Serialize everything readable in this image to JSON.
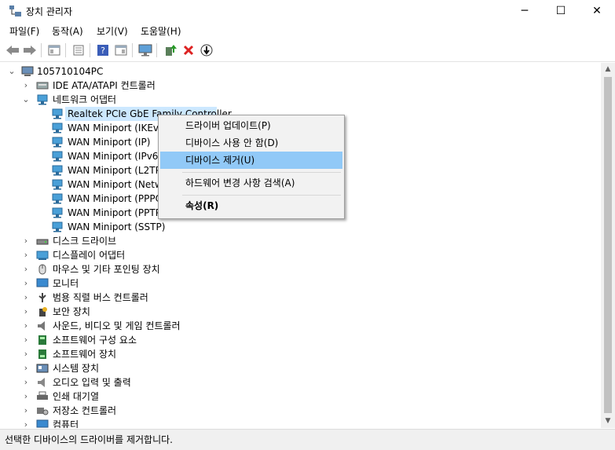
{
  "window": {
    "title": "장치 관리자",
    "minimize_glyph": "─",
    "maximize_glyph": "☐",
    "close_glyph": "✕"
  },
  "menu": [
    "파일(F)",
    "동작(A)",
    "보기(V)",
    "도움말(H)"
  ],
  "toolbar": [
    "back-icon",
    "forward-icon",
    "properties-icon",
    "driver-details-icon",
    "help-icon",
    "view-icon",
    "monitor-icon",
    "update-driver-icon",
    "uninstall-icon",
    "rollback-icon"
  ],
  "tree": {
    "root": "105710104PC",
    "expanded_category": "네트워크 어댑터",
    "adapters": [
      "Realtek PCIe GbE Family Controller",
      "WAN Miniport (IKEv2)",
      "WAN Miniport (IP)",
      "WAN Miniport (IPv6)",
      "WAN Miniport (L2TP)",
      "WAN Miniport (Network Monitor)",
      "WAN Miniport (PPPOE)",
      "WAN Miniport (PPTP)",
      "WAN Miniport (SSTP)"
    ],
    "categories_before": [
      "IDE ATA/ATAPI 컨트롤러"
    ],
    "categories_after": [
      "디스크 드라이브",
      "디스플레이 어댑터",
      "마우스 및 기타 포인팅 장치",
      "모니터",
      "범용 직렬 버스 컨트롤러",
      "보안 장치",
      "사운드, 비디오 및 게임 컨트롤러",
      "소프트웨어 구성 요소",
      "소프트웨어 장치",
      "시스템 장치",
      "오디오 입력 및 출력",
      "인쇄 대기열",
      "저장소 컨트롤러",
      "컴퓨터"
    ]
  },
  "context_menu": {
    "items": [
      "드라이버 업데이트(P)",
      "디바이스 사용 안 함(D)",
      "디바이스 제거(U)",
      "하드웨어 변경 사항 검색(A)",
      "속성(R)"
    ],
    "highlighted": "디바이스 제거(U)"
  },
  "status_bar": "선택한 디바이스의 드라이버를 제거합니다.",
  "colors": {
    "selection": "#cce8ff",
    "menu_highlight": "#91c9f7"
  }
}
